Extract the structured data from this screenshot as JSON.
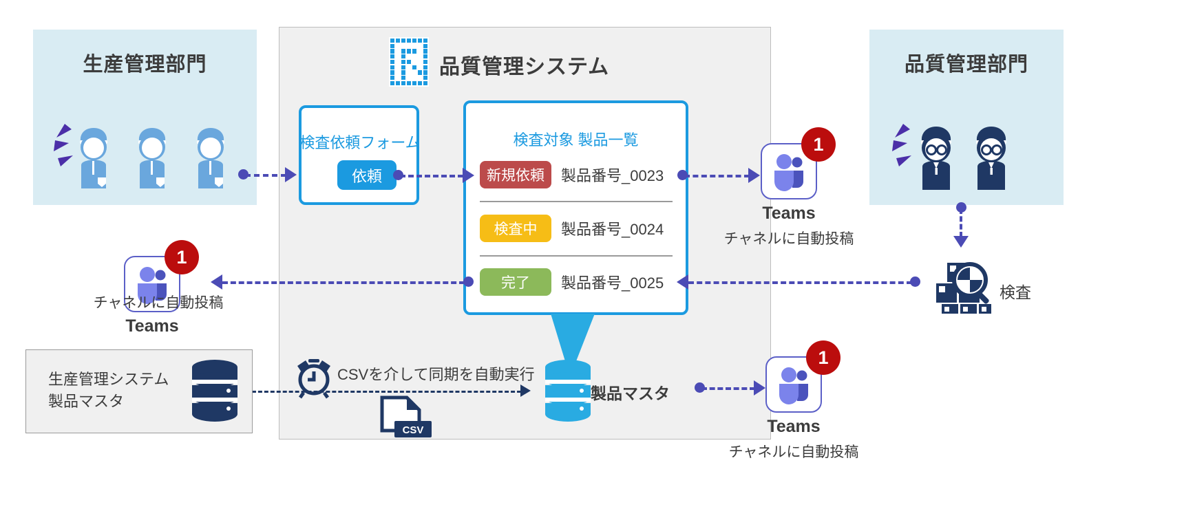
{
  "departments": {
    "production": {
      "title": "生産管理部門"
    },
    "quality": {
      "title": "品質管理部門"
    }
  },
  "system": {
    "title": "品質管理システム",
    "logo_name": "f-logo-icon",
    "request_form": {
      "title": "検査依頼フォーム",
      "button_label": "依頼"
    },
    "product_list": {
      "title": "検査対象 製品一覧",
      "rows": [
        {
          "status": "新規依頼",
          "status_color": "#bc4b4b",
          "product": "製品番号_0023"
        },
        {
          "status": "検査中",
          "status_color": "#f6bd16",
          "product": "製品番号_0024"
        },
        {
          "status": "完了",
          "status_color": "#8cb95a",
          "product": "製品番号_0025"
        }
      ]
    },
    "product_master": {
      "label": "製品マスタ",
      "color": "#29abe2"
    },
    "sync_note": "CSVを介して同期を自動実行",
    "csv_file_label": "CSV",
    "clock_icon": "alarm-clock-icon"
  },
  "teams_nodes": [
    {
      "id": "teams-quality",
      "label": "Teams",
      "badge": "1",
      "sub": "チャネルに自動投稿"
    },
    {
      "id": "teams-production",
      "label": "Teams",
      "badge": "1",
      "sub": "チャネルに自動投稿"
    },
    {
      "id": "teams-master",
      "label": "Teams",
      "badge": "1",
      "sub": "チャネルに自動投稿"
    }
  ],
  "legacy_system": {
    "line1": "生産管理システム",
    "line2": "製品マスタ",
    "db_color": "#1f3864"
  },
  "inspection": {
    "label": "検査",
    "icon": "boxes-magnifier-icon"
  },
  "colors": {
    "accent_blue": "#1b9ae0",
    "panel_blue": "#d9ecf3",
    "panel_gray": "#f0f0f0",
    "arrow_purple": "#4b4bb5",
    "navy": "#1f3864",
    "badge_red": "#bb0d0d",
    "teams_purple": "#5b5fc7"
  }
}
